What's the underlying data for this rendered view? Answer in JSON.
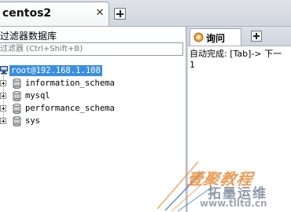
{
  "connection_tab": {
    "title": "centos2",
    "close_glyph": "✕"
  },
  "object_browser": {
    "filter_title": "过滤器数据库",
    "filter_placeholder": "过滤器 (Ctrl+Shift+B)",
    "server_node": "root@192.168.1.108",
    "databases": [
      {
        "name": "information_schema",
        "icon": "database-icon"
      },
      {
        "name": "mysql",
        "icon": "database-icon"
      },
      {
        "name": "performance_schema",
        "icon": "database-icon"
      },
      {
        "name": "sys",
        "icon": "database-icon"
      }
    ]
  },
  "query_panel": {
    "tab_label": "询问",
    "tab_icon": "query-icon",
    "autocomplete_hint": "自动完成: [Tab]-> 下一",
    "line_numbers": [
      "1"
    ]
  },
  "watermark": {
    "title": "壹聚教程",
    "subtitle": "拓墨运维",
    "url": "www.tlltd.cn"
  },
  "colors": {
    "selection": "#3b8fe0",
    "tab_bar": "#d2d7de",
    "watermark_orange": "#e58c3c",
    "watermark_slate": "#5e6f82"
  }
}
